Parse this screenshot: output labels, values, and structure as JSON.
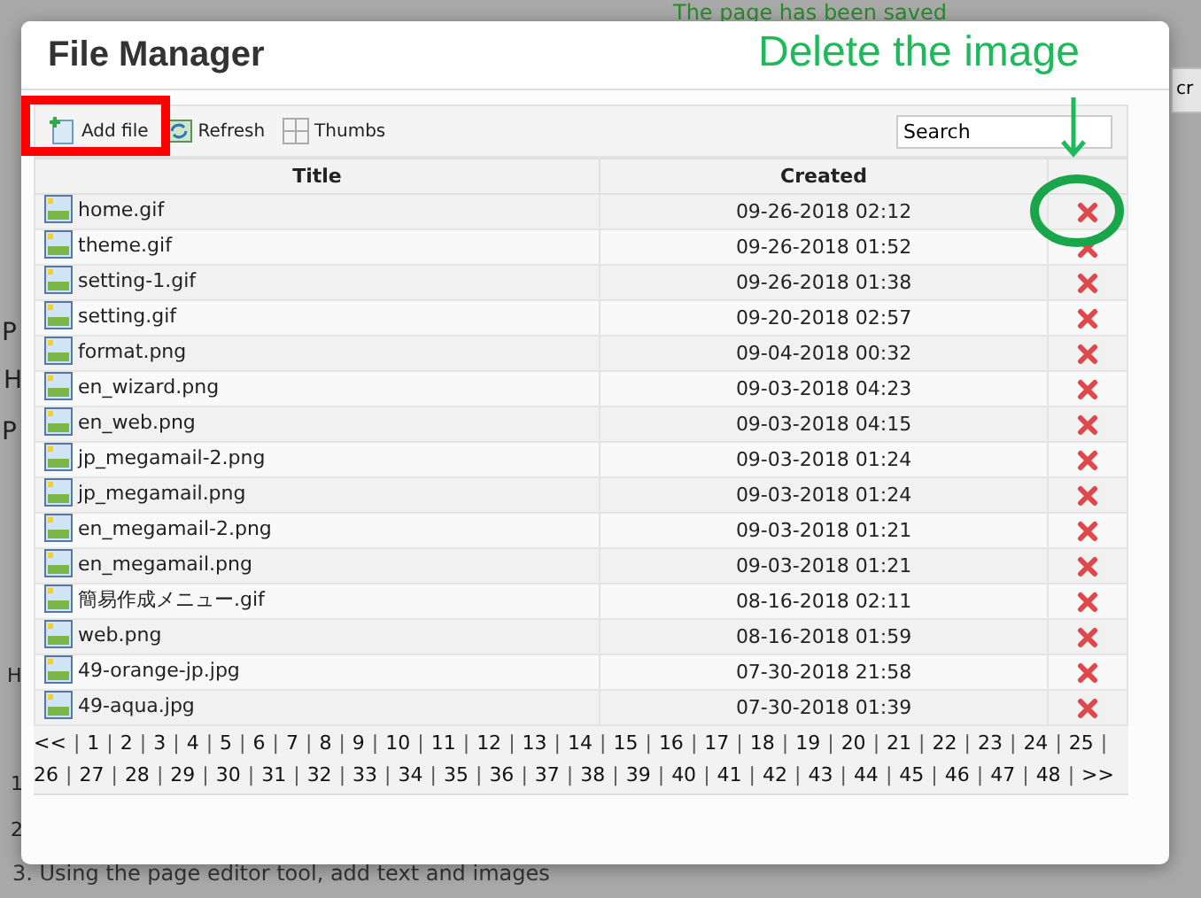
{
  "background": {
    "notice": "The page has been saved",
    "side_texts": [
      "P",
      "H",
      "P",
      "H",
      "1",
      "2"
    ],
    "side_button": "cr",
    "step": "3. Using the page editor tool, add text and images"
  },
  "dialog": {
    "title": "File Manager",
    "toolbar": [
      {
        "label": "Add file",
        "kind": "add"
      },
      {
        "label": "Refresh",
        "kind": "refresh"
      },
      {
        "label": "Thumbs",
        "kind": "thumbs"
      }
    ],
    "search": {
      "value": "Search"
    },
    "table": {
      "columns": [
        "Title",
        "Created"
      ],
      "rows": [
        {
          "name": "home.gif",
          "created": "09-26-2018 02:12"
        },
        {
          "name": "theme.gif",
          "created": "09-26-2018 01:52"
        },
        {
          "name": "setting-1.gif",
          "created": "09-26-2018 01:38"
        },
        {
          "name": "setting.gif",
          "created": "09-20-2018 02:57"
        },
        {
          "name": "format.png",
          "created": "09-04-2018 00:32"
        },
        {
          "name": "en_wizard.png",
          "created": "09-03-2018 04:23"
        },
        {
          "name": "en_web.png",
          "created": "09-03-2018 04:15"
        },
        {
          "name": "jp_megamail-2.png",
          "created": "09-03-2018 01:24"
        },
        {
          "name": "jp_megamail.png",
          "created": "09-03-2018 01:24"
        },
        {
          "name": "en_megamail-2.png",
          "created": "09-03-2018 01:21"
        },
        {
          "name": "en_megamail.png",
          "created": "09-03-2018 01:21"
        },
        {
          "name": "簡易作成メニュー.gif",
          "created": "08-16-2018 02:11"
        },
        {
          "name": "web.png",
          "created": "08-16-2018 01:59"
        },
        {
          "name": "49-orange-jp.jpg",
          "created": "07-30-2018 21:58"
        },
        {
          "name": "49-aqua.jpg",
          "created": "07-30-2018 01:39"
        }
      ]
    },
    "pagination": {
      "separator": "|",
      "pages": [
        "<<",
        "1",
        "2",
        "3",
        "4",
        "5",
        "6",
        "7",
        "8",
        "9",
        "10",
        "11",
        "12",
        "13",
        "14",
        "15",
        "16",
        "17",
        "18",
        "19",
        "20",
        "21",
        "22",
        "23",
        "24",
        "25",
        "26",
        "27",
        "28",
        "29",
        "30",
        "31",
        "32",
        "33",
        "34",
        "35",
        "36",
        "37",
        "38",
        "39",
        "40",
        "41",
        "42",
        "43",
        "44",
        "45",
        "46",
        "47",
        "48",
        ">>"
      ]
    }
  },
  "annotation": {
    "caption": "Delete the image"
  }
}
